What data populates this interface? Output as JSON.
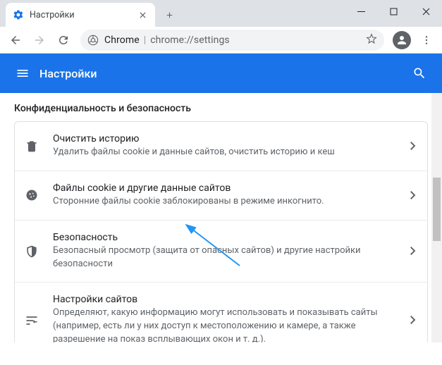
{
  "window": {
    "tab_title": "Настройки"
  },
  "omnibox": {
    "host": "Chrome",
    "path": "chrome://settings"
  },
  "header": {
    "title": "Настройки"
  },
  "section": {
    "title": "Конфиденциальность и безопасность"
  },
  "rows": [
    {
      "title": "Очистить историю",
      "subtitle": "Удалить файлы cookie и данные сайтов, очистить историю и кеш"
    },
    {
      "title": "Файлы cookie и другие данные сайтов",
      "subtitle": "Сторонние файлы cookie заблокированы в режиме инкогнито."
    },
    {
      "title": "Безопасность",
      "subtitle": "Безопасный просмотр (защита от опасных сайтов) и другие настройки безопасности"
    },
    {
      "title": "Настройки сайтов",
      "subtitle": "Определяют, какую информацию могут использовать и показывать сайты (например, есть ли у них доступ к местоположению и камере, а также разрешение на показ всплывающих окон и т. д.)."
    }
  ]
}
